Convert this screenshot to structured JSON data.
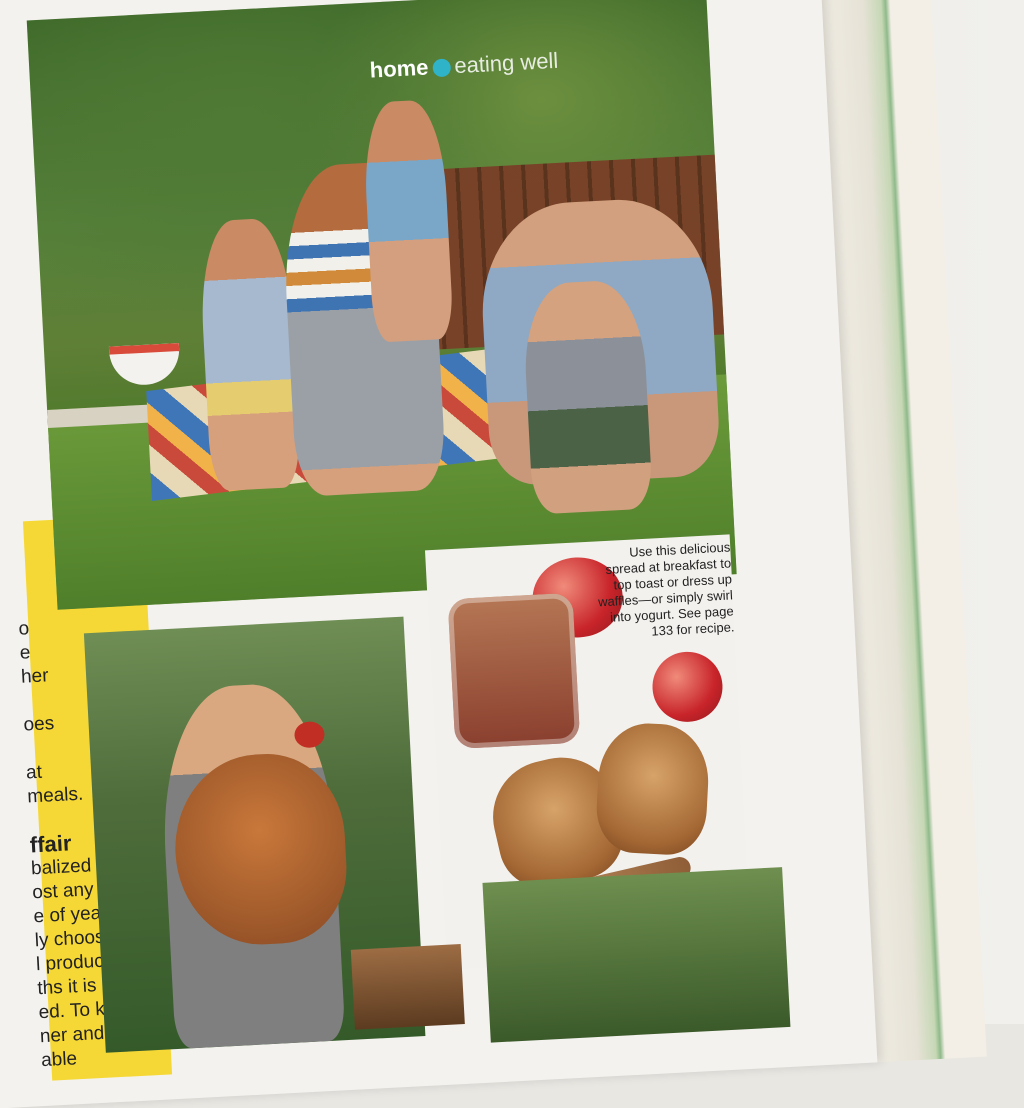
{
  "header": {
    "section": "home",
    "subsection": "eating well"
  },
  "caption": {
    "lines": [
      "Use this delicious",
      "spread at breakfast to",
      "top toast or dress up",
      "waffles—or simply swirl",
      "into yogurt. See page",
      "133 for recipe."
    ]
  },
  "sidebar": {
    "lines_top": [
      "o",
      "e",
      "her",
      "",
      "oes",
      "",
      "at",
      "meals."
    ],
    "heading": "ffair",
    "lines_bottom": [
      "balized",
      "ost any",
      "e of year,",
      "ly chooses",
      "l produce",
      "ths it is",
      "ed. To keep",
      "ner and fall",
      "able"
    ]
  },
  "colors": {
    "accent_dot": "#2fb3c9",
    "sidebar_yellow": "#f5d836"
  }
}
